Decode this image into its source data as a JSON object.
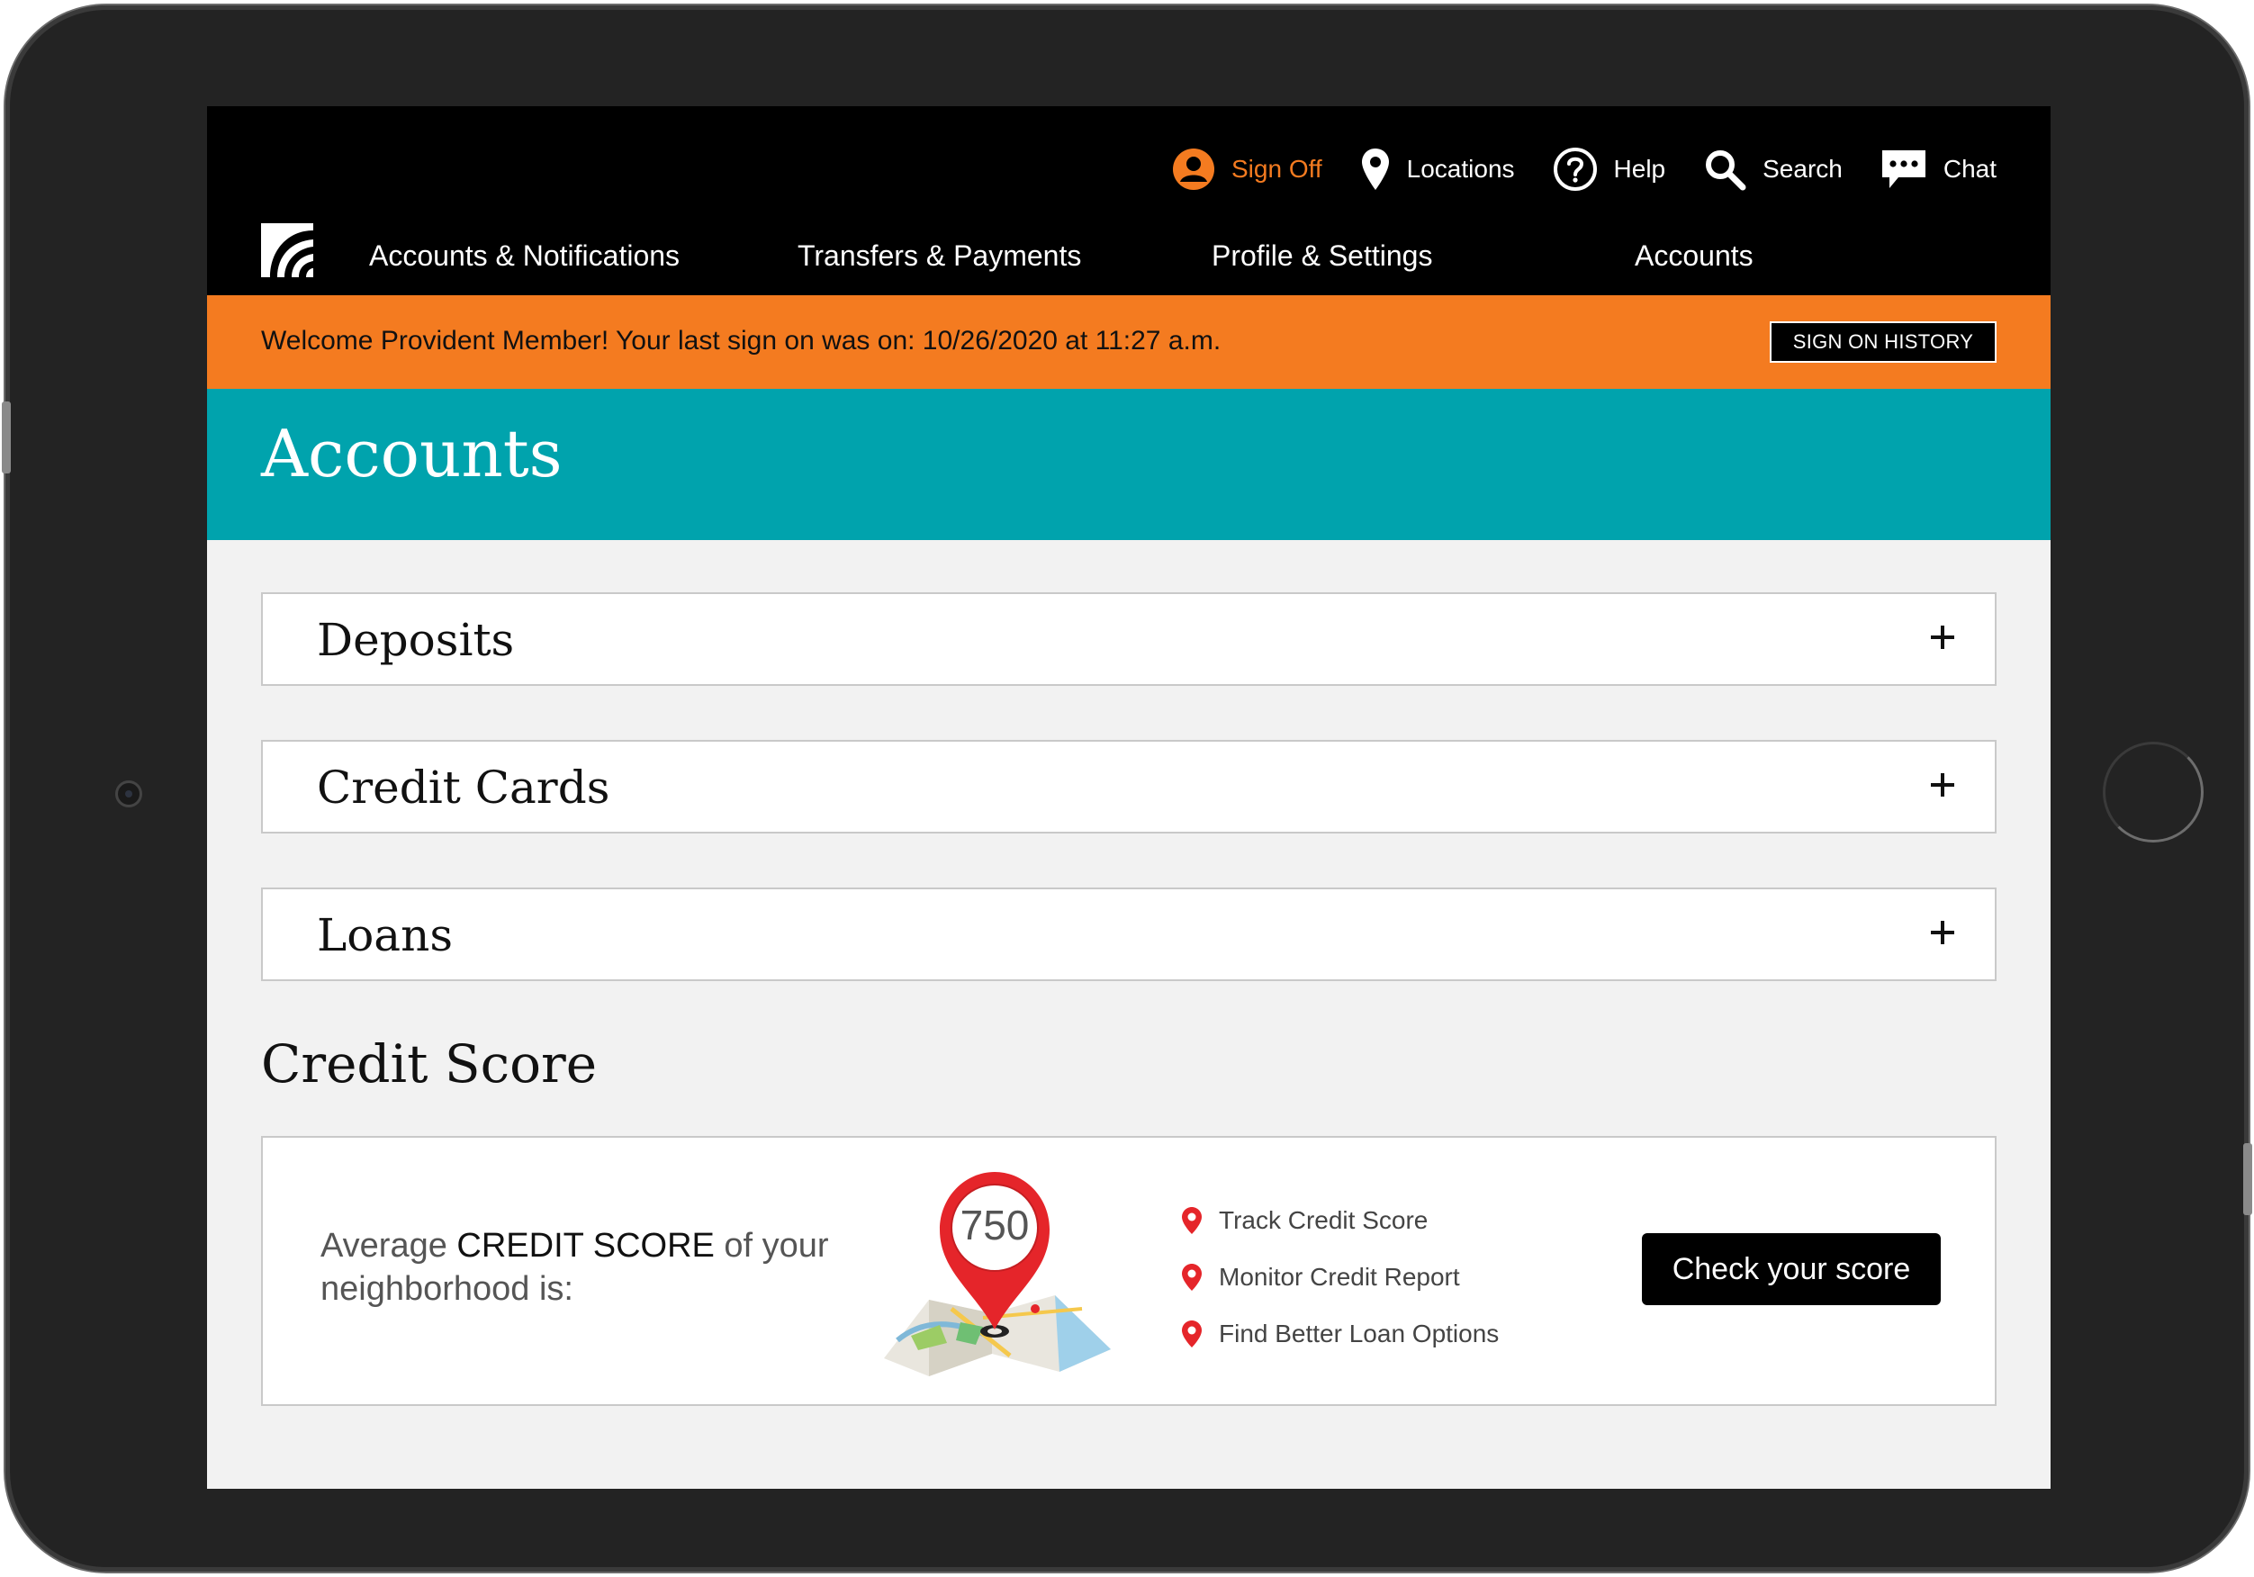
{
  "utility_nav": {
    "sign_off": "Sign Off",
    "locations": "Locations",
    "help": "Help",
    "search": "Search",
    "chat": "Chat"
  },
  "main_nav": [
    "Accounts & Notifications",
    "Transfers & Payments",
    "Profile & Settings",
    "Accounts"
  ],
  "welcome": {
    "message": "Welcome Provident Member! Your last sign on was on: 10/26/2020 at 11:27 a.m.",
    "history_button": "SIGN ON HISTORY"
  },
  "page_title": "Accounts",
  "accordions": [
    "Deposits",
    "Credit Cards",
    "Loans"
  ],
  "credit_score": {
    "section_title": "Credit Score",
    "text_prefix": "Average ",
    "text_strong": "CREDIT SCORE",
    "text_suffix": " of your neighborhood is:",
    "score": "750",
    "features": [
      "Track Credit Score",
      "Monitor Credit Report",
      "Find Better Loan Options"
    ],
    "button": "Check your score"
  },
  "colors": {
    "accent_orange": "#f47b20",
    "teal": "#00a3ad",
    "pin_red": "#e5252a"
  },
  "icons": [
    "user-icon",
    "location-pin-icon",
    "help-icon",
    "search-icon",
    "chat-icon",
    "plus-icon",
    "map-pin-icon"
  ]
}
